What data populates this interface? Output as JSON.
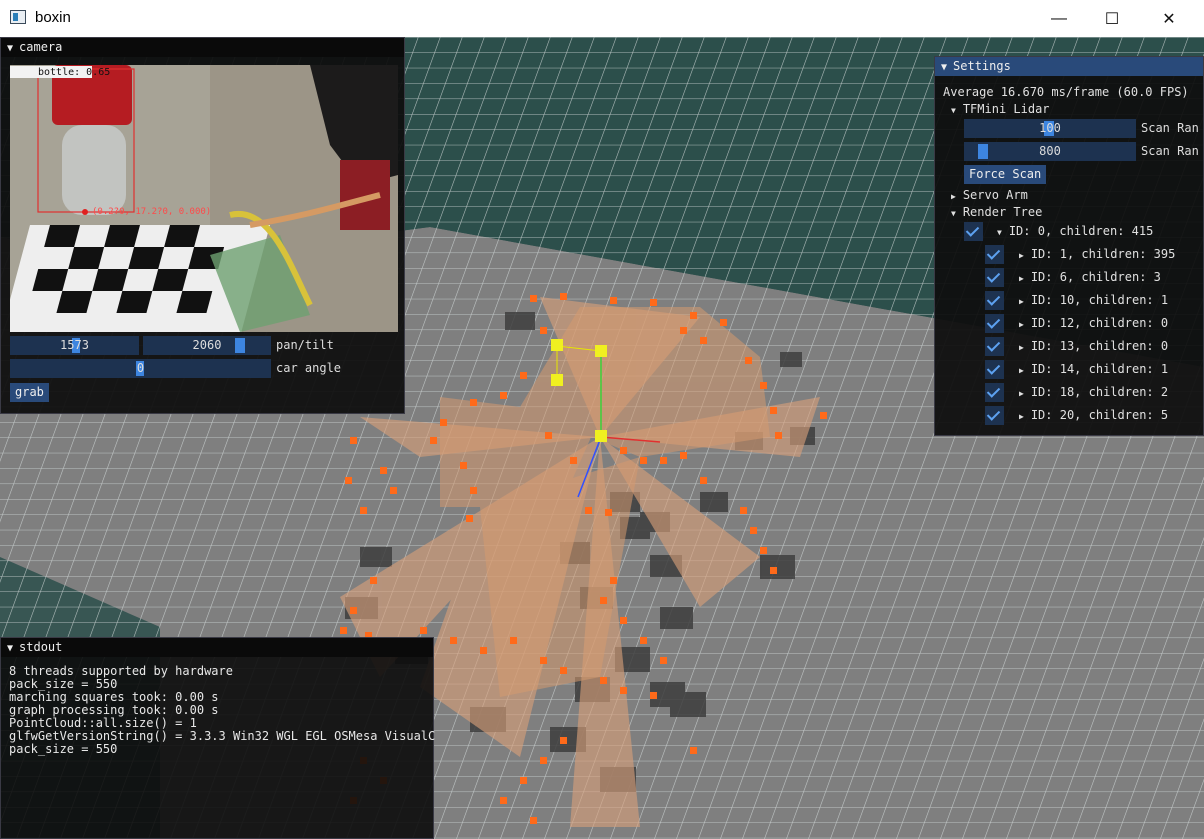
{
  "window": {
    "title": "boxin",
    "minimize": "—",
    "maximize": "☐",
    "close": "✕"
  },
  "camera": {
    "title": "camera",
    "detection_label": "bottle: 0.65",
    "detection_coords": "(0.2?0, 17.2?0, 0.000)",
    "pan": "1573",
    "tilt": "2060",
    "pan_tilt_label": "pan/tilt",
    "car_angle": "0",
    "car_angle_label": "car angle",
    "grab_label": "grab"
  },
  "settings": {
    "title": "Settings",
    "fps_text": "Average 16.670 ms/frame (60.0 FPS)",
    "lidar_header": "TFMini Lidar",
    "scan_range_min": "100",
    "scan_range_max": "800",
    "scan_range_label": "Scan Ran",
    "force_scan_label": "Force Scan",
    "servo_arm_header": "Servo Arm",
    "render_tree_header": "Render Tree",
    "root_node": "ID: 0, children: 415",
    "nodes": [
      "ID: 1, children: 395",
      "ID: 6, children: 3",
      "ID: 10, children: 1",
      "ID: 12, children: 0",
      "ID: 13, children: 0",
      "ID: 14, children: 1",
      "ID: 18, children: 2",
      "ID: 20, children: 5"
    ]
  },
  "stdout": {
    "title": "stdout",
    "lines": [
      "8 threads supported by hardware",
      "pack_size = 550",
      "marching squares took: 0.00 s",
      "graph processing took: 0.00 s",
      "PointCloud::all.size() = 1",
      "glfwGetVersionString() = 3.3.3 Win32 WGL EGL OSMesa VisualC",
      "pack_size = 550"
    ]
  },
  "colors": {
    "accent": "#294a7a",
    "point": "#ff6a1a",
    "slider": "#1d3250",
    "grab": "#3d85e0"
  }
}
